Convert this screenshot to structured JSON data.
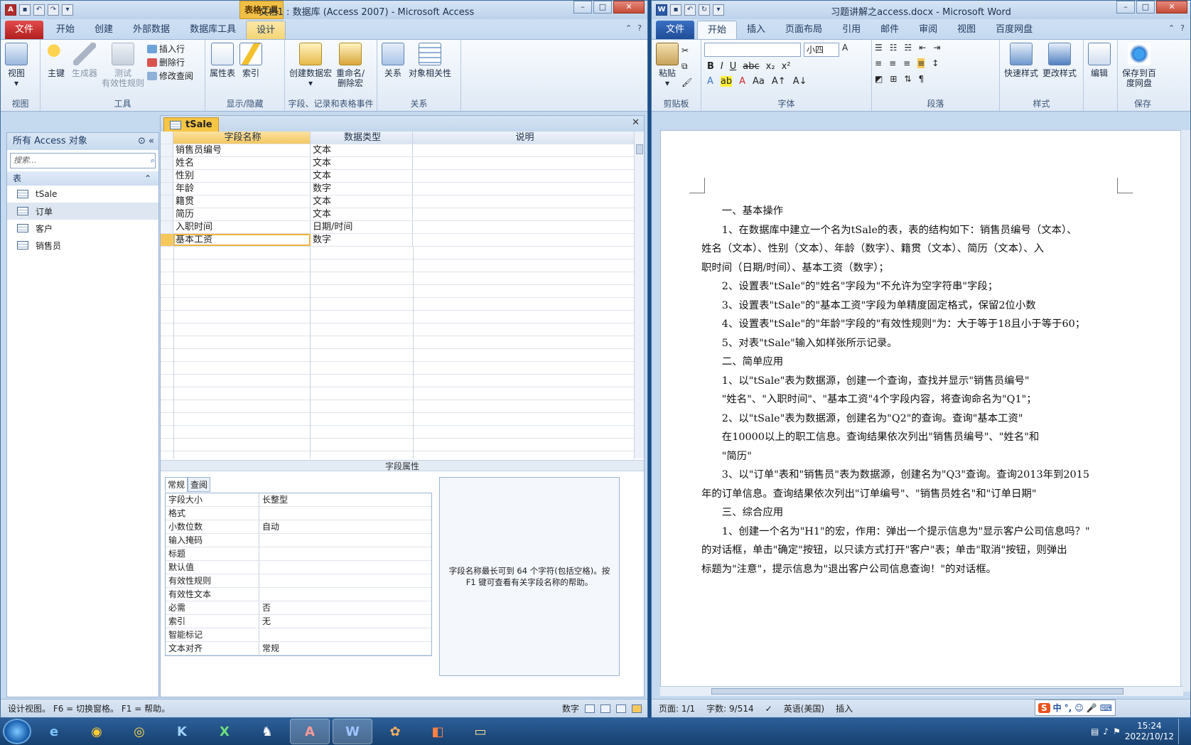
{
  "access": {
    "title": "文档1 : 数据库 (Access 2007)  -  Microsoft Access",
    "context_tab": "表格工具",
    "tabs": [
      "文件",
      "开始",
      "创建",
      "外部数据",
      "数据库工具",
      "设计"
    ],
    "ribbon": {
      "view": "视图",
      "view_group": "视图",
      "primary_key": "主键",
      "builder": "生成器",
      "test_rules": "测试\n有效性规则",
      "insert_row": "插入行",
      "delete_row": "删除行",
      "modify_lookup": "修改查阅",
      "tools_group": "工具",
      "property_sheet": "属性表",
      "indexes": "索引",
      "show_hide_group": "显示/隐藏",
      "create_macro": "创建数据宏",
      "rename_macro": "重命名/\n删除宏",
      "events_group": "字段、记录和表格事件",
      "relationships": "关系",
      "object_deps": "对象相关性",
      "rel_group": "关系"
    },
    "nav": {
      "header": "所有 Access 对象",
      "search_placeholder": "搜索...",
      "group": "表",
      "items": [
        "tSale",
        "订单",
        "客户",
        "销售员"
      ]
    },
    "doc_tab": "tSale",
    "grid": {
      "headers": [
        "字段名称",
        "数据类型",
        "说明"
      ],
      "rows": [
        [
          "销售员编号",
          "文本"
        ],
        [
          "姓名",
          "文本"
        ],
        [
          "性别",
          "文本"
        ],
        [
          "年龄",
          "数字"
        ],
        [
          "籍贯",
          "文本"
        ],
        [
          "简历",
          "文本"
        ],
        [
          "入职时间",
          "日期/时间"
        ],
        [
          "基本工资",
          "数字"
        ]
      ]
    },
    "field_props_title": "字段属性",
    "prop_tabs": [
      "常规",
      "查阅"
    ],
    "props": [
      [
        "字段大小",
        "长整型"
      ],
      [
        "格式",
        ""
      ],
      [
        "小数位数",
        "自动"
      ],
      [
        "输入掩码",
        ""
      ],
      [
        "标题",
        ""
      ],
      [
        "默认值",
        ""
      ],
      [
        "有效性规则",
        ""
      ],
      [
        "有效性文本",
        ""
      ],
      [
        "必需",
        "否"
      ],
      [
        "索引",
        "无"
      ],
      [
        "智能标记",
        ""
      ],
      [
        "文本对齐",
        "常规"
      ]
    ],
    "help": "字段名称最长可到 64 个字符(包括空格)。按 F1 键可查看有关字段名称的帮助。",
    "status_left": "设计视图。  F6 = 切换窗格。  F1 = 帮助。",
    "status_right": "数字"
  },
  "word": {
    "title": "习题讲解之access.docx  -  Microsoft Word",
    "tabs": [
      "文件",
      "开始",
      "插入",
      "页面布局",
      "引用",
      "邮件",
      "审阅",
      "视图",
      "百度网盘"
    ],
    "ribbon": {
      "paste": "粘贴",
      "clipboard": "剪贴板",
      "font_size": "小四",
      "font_group": "字体",
      "para_group": "段落",
      "quick_styles": "快速样式",
      "change_styles": "更改样式",
      "styles_group": "样式",
      "edit": "编辑",
      "save_baidu": "保存到百\n度网盘",
      "save_group": "保存"
    },
    "doc": [
      "一、基本操作",
      "1、在数据库中建立一个名为tSale的表，表的结构如下：销售员编号（文本）、",
      "姓名（文本）、性别（文本）、年龄（数字）、籍贯（文本）、简历（文本）、入",
      "职时间（日期/时间）、基本工资（数字）；",
      "2、设置表\"tSale\"的\"姓名\"字段为\"不允许为空字符串\"字段；",
      "3、设置表\"tSale\"的\"基本工资\"字段为单精度固定格式，保留2位小数",
      "4、设置表\"tSale\"的\"年龄\"字段的\"有效性规则\"为：大于等于18且小于等于60；",
      "5、对表\"tSale\"输入如样张所示记录。",
      "二、简单应用",
      "1、以\"tSale\"表为数据源，创建一个查询，查找并显示\"销售员编号\"",
      "\"姓名\"、\"入职时间\"、\"基本工资\"4个字段内容，将查询命名为\"Q1\"；",
      "2、以\"tSale\"表为数据源，创建名为\"Q2\"的查询。查询\"基本工资\"",
      "在10000以上的职工信息。查询结果依次列出\"销售员编号\"、\"姓名\"和",
      "\"简历\"",
      "3、以\"订单\"表和\"销售员\"表为数据源，创建名为\"Q3\"查询。查询2013年到2015",
      "年的订单信息。查询结果依次列出\"订单编号\"、\"销售员姓名\"和\"订单日期\"",
      "三、综合应用",
      "1、创建一个名为\"H1\"的宏，作用：弹出一个提示信息为\"显示客户公司信息吗？\"",
      "的对话框，单击\"确定\"按钮，以只读方式打开\"客户\"表；单击\"取消\"按钮，则弹出",
      "标题为\"注意\"，提示信息为\"退出客户公司信息查询！\"的对话框。"
    ],
    "status": {
      "page": "页面: 1/1",
      "words": "字数: 9/514",
      "lang": "英语(美国)",
      "mode": "插入"
    }
  },
  "taskbar": {
    "time": "15:24",
    "date": "2022/10/12",
    "ime": "中"
  }
}
